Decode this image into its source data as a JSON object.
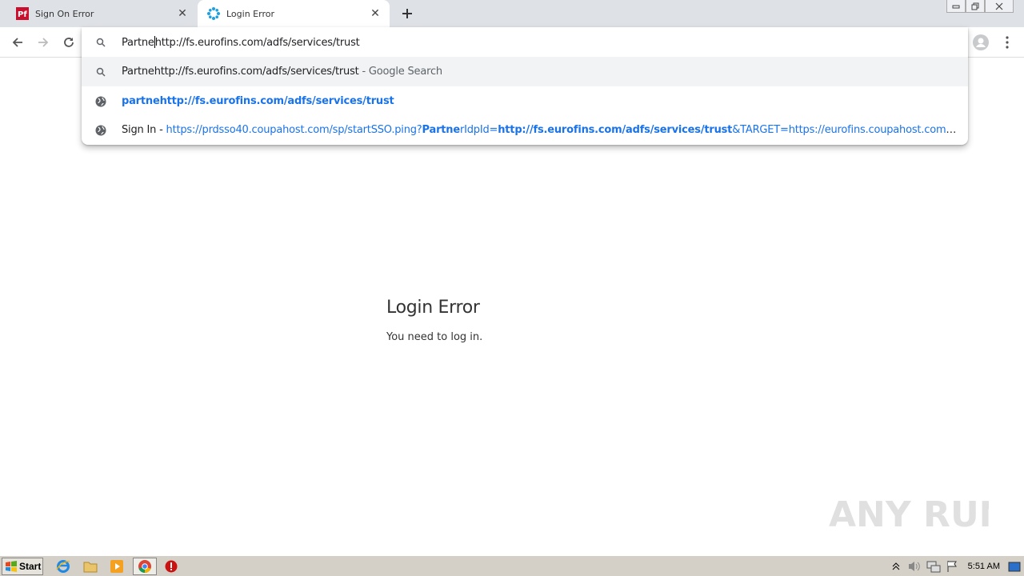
{
  "tabs": [
    {
      "title": "Sign On Error",
      "favicon": "pf-icon",
      "active": false
    },
    {
      "title": "Login Error",
      "favicon": "spinner-icon",
      "active": true
    }
  ],
  "omnibox": {
    "input_before_caret": "Partne",
    "input_after_caret": "http://fs.eurofins.com/adfs/services/trust",
    "suggestions": [
      {
        "icon": "search-icon",
        "text": "Partnehttp://fs.eurofins.com/adfs/services/trust",
        "suffix": " - Google Search"
      },
      {
        "icon": "globe-icon",
        "text": "partnehttp://fs.eurofins.com/adfs/services/trust"
      },
      {
        "icon": "globe-icon",
        "title": "Sign In",
        "sep": " - ",
        "url_parts": [
          "https://prdsso40.coupahost.com/sp/startSSO.ping?",
          "Partne",
          "rIdpId=",
          "http://fs.eurofins.com/adfs/services/trust",
          "&TARGET=https://eurofins.coupahost.com/..."
        ]
      }
    ]
  },
  "page": {
    "heading": "Login Error",
    "message": "You need to log in."
  },
  "watermark": {
    "text": "ANY RUN"
  },
  "taskbar": {
    "start_label": "Start",
    "clock": "5:51 AM"
  },
  "colors": {
    "link_blue": "#1a73e8",
    "tab_strip": "#dee1e6",
    "taskbar": "#d4d0c8"
  }
}
